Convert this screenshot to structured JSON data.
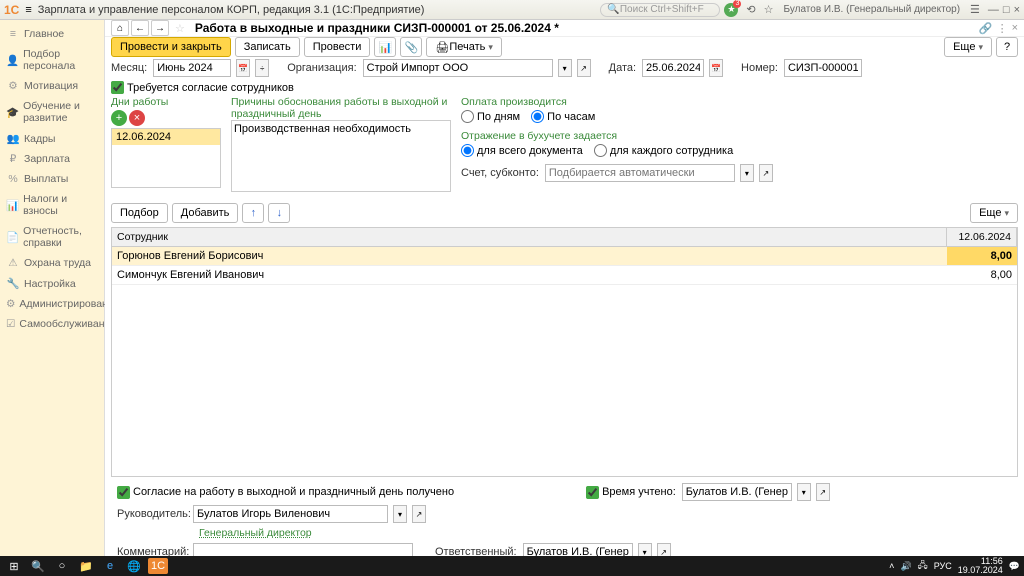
{
  "titlebar": {
    "app_title": "Зарплата и управление персоналом КОРП, редакция 3.1  (1С:Предприятие)",
    "search_placeholder": "Поиск Ctrl+Shift+F",
    "user": "Булатов И.В. (Генеральный директор)"
  },
  "sidebar": {
    "items": [
      {
        "icon": "≡",
        "label": "Главное"
      },
      {
        "icon": "👤",
        "label": "Подбор персонала"
      },
      {
        "icon": "⚙",
        "label": "Мотивация"
      },
      {
        "icon": "🎓",
        "label": "Обучение и развитие"
      },
      {
        "icon": "👥",
        "label": "Кадры"
      },
      {
        "icon": "₽",
        "label": "Зарплата"
      },
      {
        "icon": "%",
        "label": "Выплаты"
      },
      {
        "icon": "📊",
        "label": "Налоги и взносы"
      },
      {
        "icon": "📄",
        "label": "Отчетность, справки"
      },
      {
        "icon": "⚠",
        "label": "Охрана труда"
      },
      {
        "icon": "🔧",
        "label": "Настройка"
      },
      {
        "icon": "⚙",
        "label": "Администрирование"
      },
      {
        "icon": "☑",
        "label": "Самообслуживание"
      }
    ]
  },
  "header": {
    "doc_title": "Работа в выходные и праздники СИЗП-000001 от 25.06.2024 *"
  },
  "toolbar": {
    "post_close": "Провести и закрыть",
    "save": "Записать",
    "post": "Провести",
    "print": "Печать",
    "more": "Еще"
  },
  "form": {
    "month_label": "Месяц:",
    "month_value": "Июнь 2024",
    "org_label": "Организация:",
    "org_value": "Строй Импорт ООО",
    "date_label": "Дата:",
    "date_value": "25.06.2024",
    "number_label": "Номер:",
    "number_value": "СИЗП-000001",
    "consent_required": "Требуется согласие сотрудников",
    "days_label": "Дни работы",
    "day_value": "12.06.2024",
    "reasons_label": "Причины обоснования работы в выходной и праздничный день",
    "reason_text": "Производственная необходимость",
    "payment_label": "Оплата производится",
    "by_days": "По дням",
    "by_hours": "По часам",
    "reflection_label": "Отражение в бухучете задается",
    "for_doc": "для всего документа",
    "for_each": "для каждого сотрудника",
    "account_label": "Счет, субконто:",
    "account_placeholder": "Подбирается автоматически",
    "select_btn": "Подбор",
    "add_btn": "Добавить"
  },
  "table": {
    "col_employee": "Сотрудник",
    "col_date": "12.06.2024",
    "rows": [
      {
        "name": "Горюнов Евгений Борисович",
        "val": "8,00",
        "sel": true
      },
      {
        "name": "Симончук Евгений Иванович",
        "val": "8,00",
        "sel": false
      }
    ]
  },
  "bottom": {
    "consent_received": "Согласие на работу в выходной и праздничный день получено",
    "time_recorded": "Время учтено:",
    "time_person": "Булатов И.В. (Генеральн",
    "manager_label": "Руководитель:",
    "manager_value": "Булатов Игорь Виленович",
    "manager_pos": "Генеральный директор",
    "comment_label": "Комментарий:",
    "responsible_label": "Ответственный:",
    "responsible_value": "Булатов И.В. (Генеральн"
  },
  "taskbar": {
    "time": "11:56",
    "date": "19.07.2024",
    "lang": "РУС"
  }
}
